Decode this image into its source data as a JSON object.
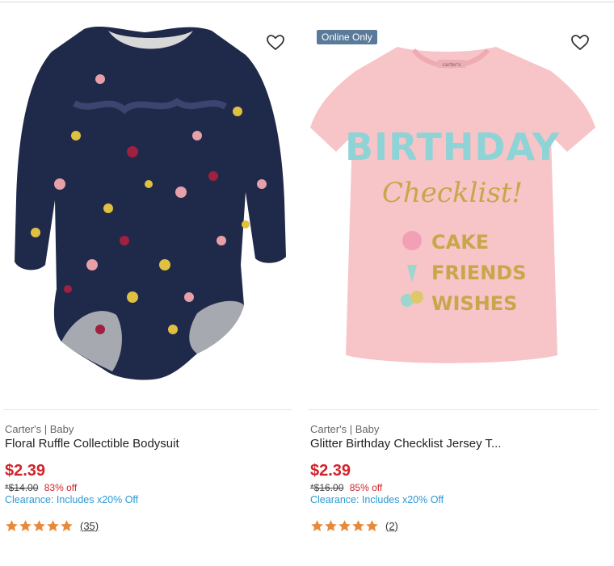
{
  "colors": {
    "price_red": "#d2232a",
    "clearance_blue": "#2a9ad6",
    "star_orange": "#e8893a",
    "badge_bg": "#5a7a99"
  },
  "products": [
    {
      "brand": "Carter's | Baby",
      "title": "Floral Ruffle Collectible Bodysuit",
      "price": "$2.39",
      "original_price": "*$14.00",
      "discount": "83% off",
      "clearance": "Clearance: Includes x20% Off",
      "rating": 5,
      "review_count": "(35)",
      "favorite_icon": "heart-outline-icon",
      "badge": ""
    },
    {
      "brand": "Carter's | Baby",
      "title": "Glitter Birthday Checklist Jersey T...",
      "price": "$2.39",
      "original_price": "*$16.00",
      "discount": "85% off",
      "clearance": "Clearance: Includes x20% Off",
      "rating": 5,
      "review_count": "(2)",
      "favorite_icon": "heart-outline-icon",
      "badge": "Online Only",
      "image_text": {
        "line1": "BIRTHDAY",
        "line2": "Checklist!",
        "items": [
          "CAKE",
          "FRIENDS",
          "WISHES"
        ],
        "tag": "carter's"
      }
    }
  ]
}
